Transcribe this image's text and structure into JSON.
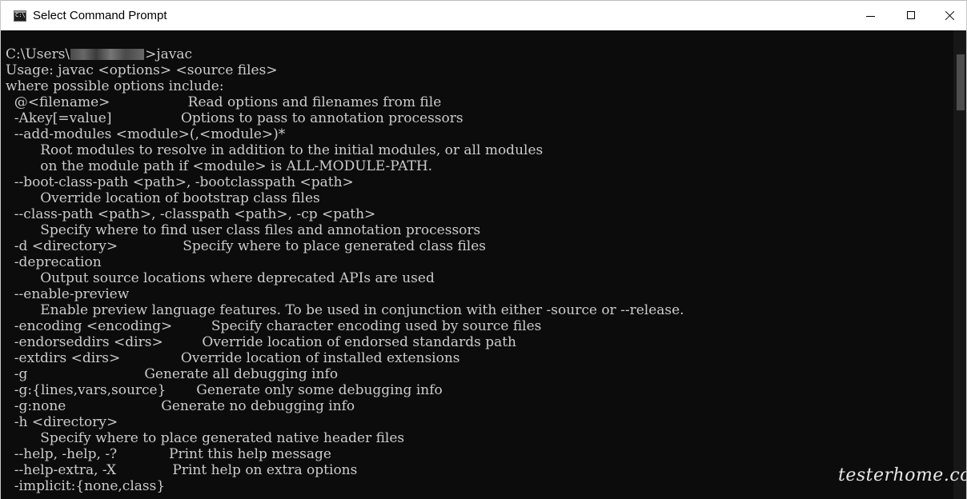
{
  "window": {
    "title": "Select Command Prompt",
    "app_icon": "cmd-icon",
    "app_icon_glyph": "C:\\",
    "controls": {
      "minimize_icon": "minimize-icon",
      "maximize_icon": "maximize-icon",
      "close_icon": "close-icon"
    }
  },
  "console": {
    "background": "#0c0c0c",
    "foreground": "#cccccc",
    "prompt": {
      "path_prefix": "C:\\Users\\",
      "command": ">javac"
    },
    "lines": [
      "Usage: javac <options> <source files>",
      "where possible options include:",
      "  @<filename>                  Read options and filenames from file",
      "  -Akey[=value]                Options to pass to annotation processors",
      "  --add-modules <module>(,<module>)*",
      "        Root modules to resolve in addition to the initial modules, or all modules",
      "        on the module path if <module> is ALL-MODULE-PATH.",
      "  --boot-class-path <path>, -bootclasspath <path>",
      "        Override location of bootstrap class files",
      "  --class-path <path>, -classpath <path>, -cp <path>",
      "        Specify where to find user class files and annotation processors",
      "  -d <directory>               Specify where to place generated class files",
      "  -deprecation",
      "        Output source locations where deprecated APIs are used",
      "  --enable-preview",
      "        Enable preview language features. To be used in conjunction with either -source or --release.",
      "  -encoding <encoding>         Specify character encoding used by source files",
      "  -endorseddirs <dirs>         Override location of endorsed standards path",
      "  -extdirs <dirs>              Override location of installed extensions",
      "  -g                           Generate all debugging info",
      "  -g:{lines,vars,source}       Generate only some debugging info",
      "  -g:none                      Generate no debugging info",
      "  -h <directory>",
      "        Specify where to place generated native header files",
      "  --help, -help, -?            Print this help message",
      "  --help-extra, -X             Print help on extra options",
      "  -implicit:{none,class}"
    ]
  },
  "watermark": "testerhome.com"
}
